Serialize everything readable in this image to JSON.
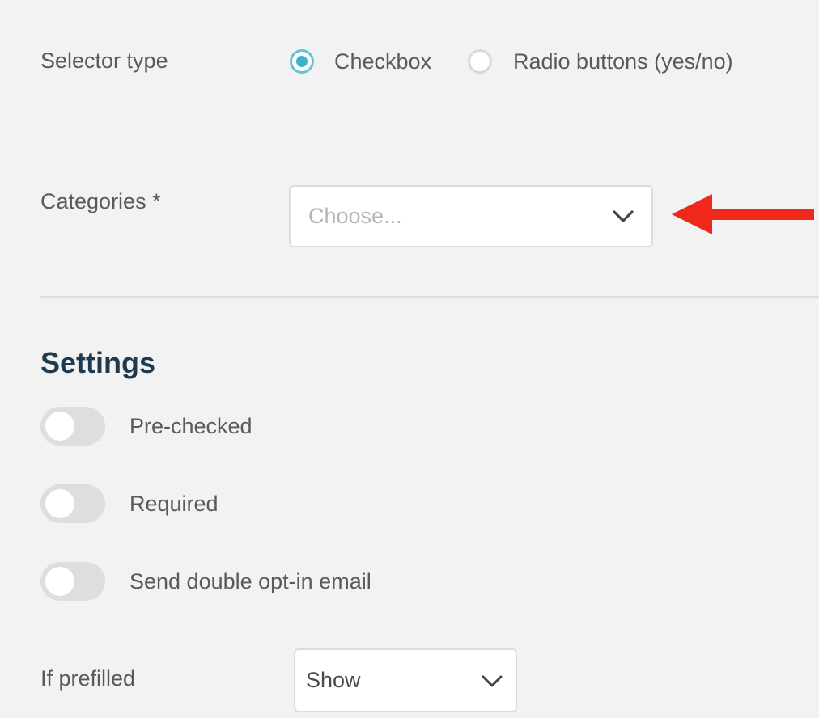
{
  "selector_type": {
    "label": "Selector type",
    "options": [
      {
        "label": "Checkbox",
        "checked": true
      },
      {
        "label": "Radio buttons (yes/no)",
        "checked": false
      }
    ]
  },
  "categories": {
    "label": "Categories *",
    "placeholder": "Choose...",
    "icon": "chevron-down-icon"
  },
  "annotation": {
    "icon": "red-arrow-icon",
    "color": "#f0281c"
  },
  "settings": {
    "title": "Settings",
    "toggles": [
      {
        "label": "Pre-checked",
        "on": false
      },
      {
        "label": "Required",
        "on": false
      },
      {
        "label": "Send double opt-in email",
        "on": false
      }
    ]
  },
  "if_prefilled": {
    "label": "If prefilled",
    "value": "Show",
    "icon": "chevron-down-icon"
  },
  "colors": {
    "accent": "#3fb1cd",
    "heading": "#1d3a4f",
    "background": "#f2f2f2"
  }
}
